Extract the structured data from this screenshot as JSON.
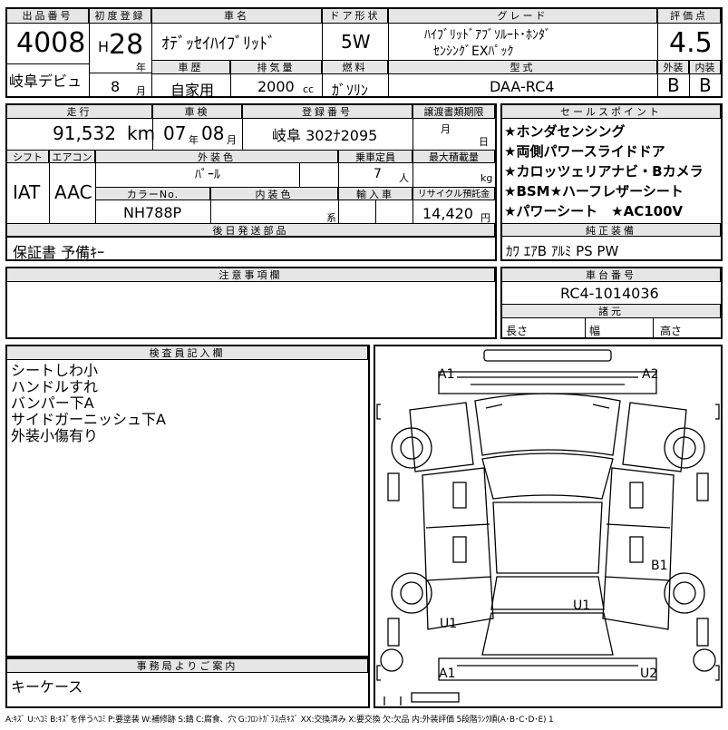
{
  "header": {
    "lot_label": "出品番号",
    "lot_number": "4008",
    "debut": "岐阜デビュ",
    "first_reg_label": "初度登録",
    "era": "H",
    "year": "28",
    "year_unit": "年",
    "month": "8",
    "month_unit": "月",
    "car_name_label": "車名",
    "car_name": "ｵﾃﾞｯｾｲﾊｲﾌﾞﾘｯﾄﾞ",
    "door_label": "ドア形状",
    "door": "5W",
    "grade_label": "グレード",
    "grade_line1": "ﾊｲﾌﾞﾘｯﾄﾞｱﾌﾞｿﾙｰﾄ･ﾎﾝﾀﾞ",
    "grade_line2": "ｾﾝｼﾝｸﾞEXﾊﾟｯｸ",
    "score_label": "評価点",
    "score": "4.5",
    "history_label": "車歴",
    "history": "自家用",
    "displacement_label": "排気量",
    "displacement": "2000",
    "displacement_unit": "cc",
    "fuel_label": "燃料",
    "fuel": "ｶﾞｿﾘﾝ",
    "model_label": "型式",
    "model": "DAA-RC4",
    "ext_label": "外装",
    "ext_grade": "B",
    "int_label": "内装",
    "int_grade": "B"
  },
  "row2": {
    "mileage_label": "走行",
    "mileage": "91,532",
    "mileage_unit": "km",
    "inspection_label": "車検",
    "insp_year": "07",
    "insp_year_unit": "年",
    "insp_month": "08",
    "insp_month_unit": "月",
    "plate_label": "登録番号",
    "plate": "岐阜 302ﾅ2095",
    "transfer_label": "譲渡書類期限",
    "transfer_month": "月",
    "transfer_day": "日",
    "shift_label": "シフト",
    "shift": "IAT",
    "ac_label": "エアコン",
    "ac": "AAC",
    "color_label": "外装色",
    "color": "ﾊﾟｰﾙ",
    "capacity_label": "乗車定員",
    "capacity": "7",
    "capacity_unit": "人",
    "load_label": "最大積載量",
    "load_unit": "kg",
    "colorno_label": "カラーNo.",
    "colorno": "NH788P",
    "intcolor_label": "内装色",
    "intcolor_unit": "系",
    "import_label": "輸入車",
    "recycle_label": "リサイクル預託金",
    "recycle": "14,420",
    "recycle_unit": "円"
  },
  "selling": {
    "label": "セールスポイント",
    "points": [
      "★ホンダセンシング",
      "★両側パワースライドドア",
      "★カロッツェリアナビ・Bカメラ",
      "★BSM★ハーフレザーシート",
      "★パワーシート　★AC100V"
    ]
  },
  "later": {
    "label": "後日発送部品",
    "value": "保証書 予備ｷｰ"
  },
  "equip": {
    "label": "純正装備",
    "value": "ｶﾜ ｴｱB ｱﾙﾐ PS PW"
  },
  "caution": {
    "label": "注意事項欄"
  },
  "chassis": {
    "label": "車台番号",
    "value": "RC4-1014036",
    "spec_label": "諸元",
    "length": "長さ",
    "width": "幅",
    "height": "高さ"
  },
  "inspector": {
    "label": "検査員記入欄",
    "notes": [
      "シートしわ小",
      "ハンドルすれ",
      "バンパー下A",
      "サイドガーニッシュ下A",
      "外装小傷有り"
    ]
  },
  "office": {
    "label": "事務局よりご案内",
    "value": "キーケース"
  },
  "diagram_marks": [
    "A1",
    "A2",
    "B1",
    "U1",
    "U1",
    "A1",
    "U2"
  ],
  "footer": "A:ｷｽﾞ U:ﾍｺﾐ B:ｷｽﾞを伴うﾍｺﾐ P:要塗装 W:補修跡 S:錆 C:腐食、穴 G:ﾌﾛﾝﾄｶﾞﾗｽ点ｷｽﾞ XX:交換済み X:要交換 欠:欠品 内:外装評価 5段階ﾗﾝｸ順(A･B･C･D･E) 1"
}
